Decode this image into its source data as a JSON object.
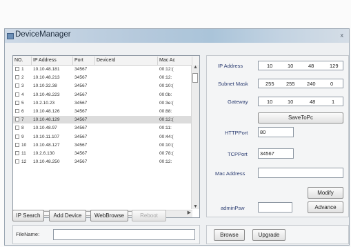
{
  "window": {
    "title": "DeviceManager",
    "close_glyph": "x"
  },
  "table": {
    "columns": [
      "NO.",
      "IP Address",
      "Port",
      "DeviceId",
      "Mac Ac"
    ],
    "rows": [
      {
        "no": "1",
        "ip": "10.10.48.181",
        "port": "34567",
        "device": "",
        "mac": "00:12:("
      },
      {
        "no": "2",
        "ip": "10.10.48.213",
        "port": "34567",
        "device": "",
        "mac": "00:12:"
      },
      {
        "no": "3",
        "ip": "10.10.32.38",
        "port": "34567",
        "device": "",
        "mac": "00:10:("
      },
      {
        "no": "4",
        "ip": "10.10.48.223",
        "port": "34567",
        "device": "",
        "mac": "00:0b:"
      },
      {
        "no": "5",
        "ip": "10.2.10.23",
        "port": "34567",
        "device": "",
        "mac": "00:3e:("
      },
      {
        "no": "6",
        "ip": "10.10.48.126",
        "port": "34567",
        "device": "",
        "mac": "00:88:"
      },
      {
        "no": "7",
        "ip": "10.10.48.129",
        "port": "34567",
        "device": "",
        "mac": "00:12:("
      },
      {
        "no": "8",
        "ip": "10.10.48.97",
        "port": "34567",
        "device": "",
        "mac": "00:11:"
      },
      {
        "no": "9",
        "ip": "10.10.11.107",
        "port": "34567",
        "device": "",
        "mac": "00:44:("
      },
      {
        "no": "10",
        "ip": "10.10.48.127",
        "port": "34567",
        "device": "",
        "mac": "00:10:("
      },
      {
        "no": "11",
        "ip": "10.2.6.130",
        "port": "34567",
        "device": "",
        "mac": "00:78:("
      },
      {
        "no": "12",
        "ip": "10.10.48.250",
        "port": "34567",
        "device": "",
        "mac": "00:12:"
      }
    ],
    "selected_row": 7,
    "scroll_up": "▲",
    "scroll_down": "▼",
    "scroll_left": "◀",
    "scroll_right": "▶"
  },
  "buttons": {
    "ip_search": "IP Search",
    "add_device": "Add Device",
    "web_browse": "WebBrowse",
    "reboot": "Reboot",
    "save_to_pc": "SaveToPc",
    "modify": "Modify",
    "advance": "Advance",
    "browse": "Browse",
    "upgrade": "Upgrade"
  },
  "network": {
    "ip_label": "IP Address",
    "ip": [
      "10",
      "10",
      "48",
      "129"
    ],
    "mask_label": "Subnet Mask",
    "mask": [
      "255",
      "255",
      "240",
      "0"
    ],
    "gateway_label": "Gateway",
    "gateway": [
      "10",
      "10",
      "48",
      "1"
    ],
    "http_label": "HTTPPort",
    "http_value": "80",
    "tcp_label": "TCPPort",
    "tcp_value": "34567",
    "mac_label": "Mac Address",
    "mac_value": "",
    "admin_label": "adminPsw",
    "admin_value": ""
  },
  "upgrade": {
    "file_label": "FileName:",
    "file_value": ""
  }
}
